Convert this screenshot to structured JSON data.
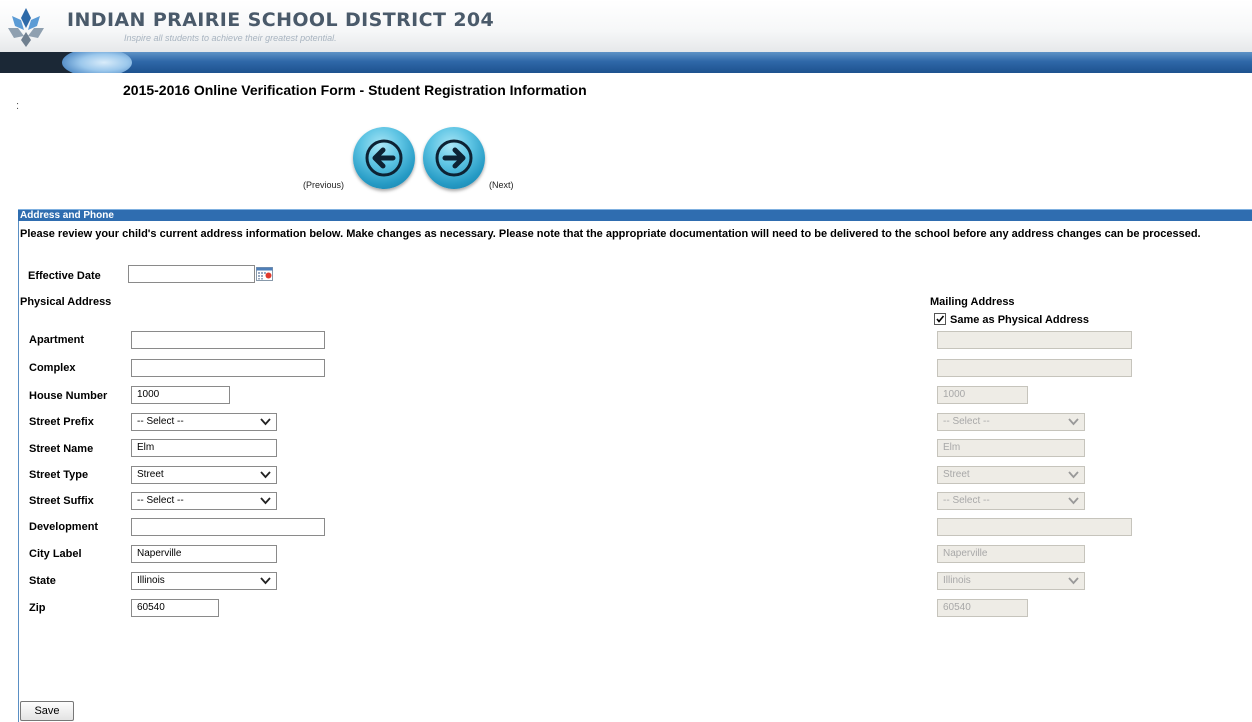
{
  "header": {
    "district_name": "INDIAN PRAIRIE SCHOOL DISTRICT 204",
    "tagline": "Inspire all students to achieve their greatest potential."
  },
  "page": {
    "title": "2015-2016 Online Verification Form - Student Registration Information",
    "stray_mark": ":"
  },
  "nav": {
    "previous_label": "(Previous)",
    "next_label": "(Next)"
  },
  "section": {
    "header": "Address and Phone",
    "instructions": "Please review your child's current address information below. Make changes as necessary. Please note that the appropriate documentation will need to be delivered to the school before any address changes can be processed."
  },
  "form": {
    "effective_date": {
      "label": "Effective Date",
      "value": ""
    },
    "physical_address_heading": "Physical Address",
    "mailing_address_heading": "Mailing Address",
    "same_as_physical": {
      "label": "Same as Physical Address",
      "checked": true
    },
    "labels": {
      "apartment": "Apartment",
      "complex": "Complex",
      "house_number": "House Number",
      "street_prefix": "Street Prefix",
      "street_name": "Street Name",
      "street_type": "Street Type",
      "street_suffix": "Street Suffix",
      "development": "Development",
      "city_label": "City Label",
      "state": "State",
      "zip": "Zip"
    },
    "physical": {
      "apartment": "",
      "complex": "",
      "house_number": "1000",
      "street_prefix": "-- Select --",
      "street_name": "Elm",
      "street_type": "Street",
      "street_suffix": "-- Select --",
      "development": "",
      "city_label": "Naperville",
      "state": "Illinois",
      "zip": "60540"
    },
    "mailing": {
      "apartment": "",
      "complex": "",
      "house_number": "1000",
      "street_prefix": "-- Select --",
      "street_name": "Elm",
      "street_type": "Street",
      "street_suffix": "-- Select --",
      "development": "",
      "city_label": "Naperville",
      "state": "Illinois",
      "zip": "60540"
    }
  },
  "save_label": "Save",
  "icons": {
    "logo": "district-logo-icon",
    "previous": "arrow-left-icon",
    "next": "arrow-right-icon",
    "calendar": "calendar-icon",
    "checkbox": "checkmark-icon",
    "dropdown": "chevron-down-icon"
  },
  "colors": {
    "banner_blue": "#2f68a8",
    "section_header": "#2f6db0",
    "nav_button": "#259ac4",
    "disabled_field": "#eeece6"
  }
}
